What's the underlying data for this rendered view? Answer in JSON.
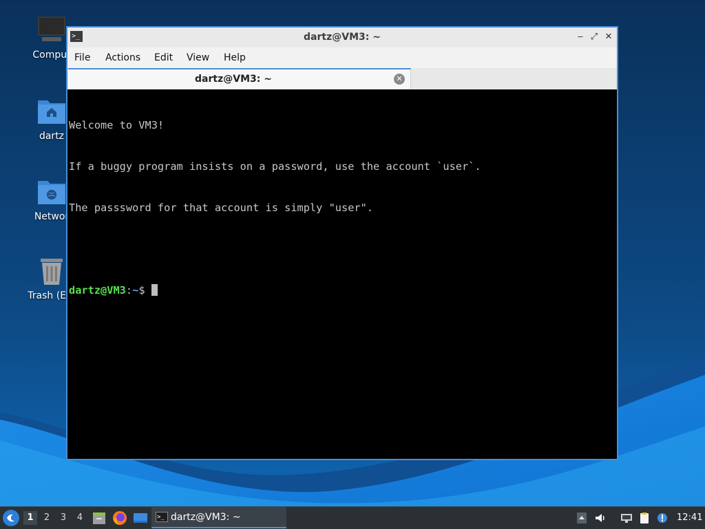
{
  "desktop": {
    "icons": [
      {
        "label": "Comput",
        "icon": "computer-icon"
      },
      {
        "label": "dartz",
        "icon": "home-folder-icon"
      },
      {
        "label": "Networ",
        "icon": "network-folder-icon"
      },
      {
        "label": "Trash (Em",
        "icon": "trash-icon"
      }
    ]
  },
  "window": {
    "title": "dartz@VM3: ~",
    "icon": "terminal-icon",
    "controls": {
      "minimize": "‒",
      "maximize": "⤢",
      "close": "✕"
    },
    "menu": [
      "File",
      "Actions",
      "Edit",
      "View",
      "Help"
    ],
    "tab": {
      "label": "dartz@VM3: ~",
      "close": "✕"
    },
    "terminal": {
      "lines": [
        "Welcome to VM3!",
        "If a buggy program insists on a password, use the account `user`.",
        "The passsword for that account is simply \"user\"."
      ],
      "prompt_user": "dartz@VM3",
      "prompt_sep": ":",
      "prompt_path": "~",
      "prompt_symbol": "$ "
    }
  },
  "taskbar": {
    "workspaces": [
      "1",
      "2",
      "3",
      "4"
    ],
    "active_workspace": "1",
    "launchers": [
      "file-manager-icon",
      "firefox-icon",
      "show-desktop-icon"
    ],
    "task_label": "dartz@VM3: ~",
    "tray": [
      "tray-arrow-icon",
      "volume-icon",
      "network-icon",
      "clipboard-icon",
      "update-icon"
    ],
    "clock": "12:41"
  },
  "colors": {
    "accent": "#4a8fd8",
    "prompt_user": "#5ae04f",
    "prompt_path": "#6f9bff",
    "terminal_bg": "#000000"
  }
}
